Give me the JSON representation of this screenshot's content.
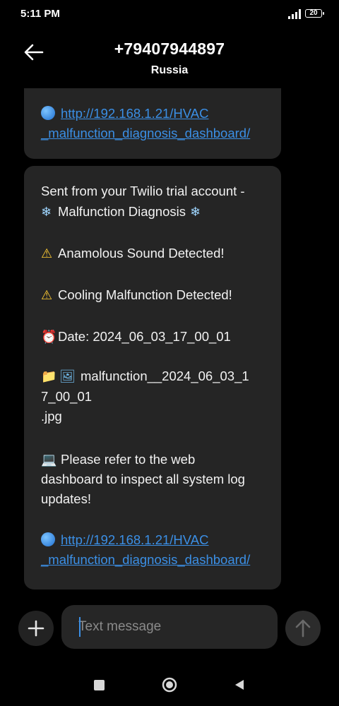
{
  "status_bar": {
    "time": "5:11 PM",
    "battery_level": "20",
    "signal_icon": "signal-bars-icon",
    "battery_icon": "battery-icon"
  },
  "header": {
    "back_icon": "arrow-left-icon",
    "title": "+79407944897",
    "subtitle": "Russia"
  },
  "messages": {
    "partial": {
      "link_line1": "http://192.168.1.21/HVAC",
      "link_line2": "_malfunction_diagnosis_dashboard/"
    },
    "full": {
      "line1": "Sent from your Twilio trial account -",
      "line2_text": "Malfunction Diagnosis",
      "snowflake": "❄",
      "warning": "⚠",
      "sound": "Anamolous Sound Detected!",
      "cooling": "Cooling Malfunction Detected!",
      "clock": "⏰",
      "date": "Date: 2024_06_03_17_00_01",
      "folder": "📁",
      "picture": "🖼",
      "file_line1": "malfunction__2024_06_03_1",
      "file_line2": "7_00_01",
      "file_line3": ".jpg",
      "laptop": "💻",
      "refer_line1": "Please refer to the web",
      "refer_line2": "dashboard to inspect all system log",
      "refer_line3": "updates!",
      "link_line1": "http://192.168.1.21/HVAC",
      "link_line2": "_malfunction_diagnosis_dashboard/"
    }
  },
  "input": {
    "placeholder": "Text message",
    "value": "",
    "add_icon": "plus-icon",
    "send_icon": "arrow-up-icon"
  },
  "navigation": {
    "recents_icon": "square-icon",
    "home_icon": "circle-icon",
    "back_icon": "triangle-back-icon"
  },
  "colors": {
    "background": "#000000",
    "bubble": "#252525",
    "link": "#3b8fe5",
    "input_bg": "#262626"
  }
}
